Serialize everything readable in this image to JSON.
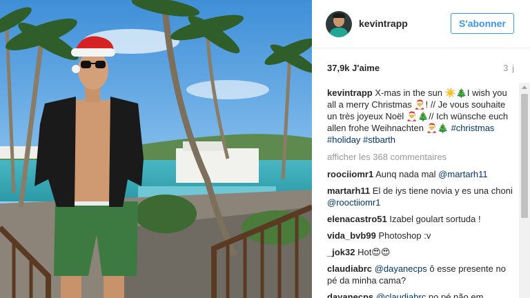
{
  "post": {
    "username": "kevintrapp",
    "follow_label": "S'abonner",
    "likes": "37,9k J'aime",
    "time_ago": "3 j"
  },
  "caption": {
    "username": "kevintrapp",
    "text": "X-mas in the sun ☀️🎄I wish you all a merry Christmas 🎅! // Je vous souhaite un très joyeux Noël 🎅🎄// Ich wünsche euch allen frohe Weihnachten 🎅🎄",
    "hashtags": "#christmas #holiday #stbarth"
  },
  "more_comments": "afficher les 368 commentaires",
  "comments": [
    {
      "user": "roociiomr1",
      "text": " Aunq nada mal ",
      "mention": "@martarh11"
    },
    {
      "user": "martarh11",
      "text": " El de iys tiene novia y es una choni ",
      "mention": "@rooctiiomr1"
    },
    {
      "user": "elenacastro51",
      "text": " Izabel goulart sortuda !",
      "mention": ""
    },
    {
      "user": "vida_bvb99",
      "text": " Photoshop :v",
      "mention": ""
    },
    {
      "user": "_jok32",
      "text": " Hot😍😍",
      "mention": ""
    },
    {
      "user": "claudiabrc",
      "text": " ô esse presente no pé da minha cama?",
      "mention": "@dayanecps",
      "mention_first": true
    },
    {
      "user": "dayanecps",
      "text": " no pé não em",
      "mention": "@claudiabrc",
      "mention_first": true
    }
  ],
  "colors": {
    "link": "#3897f0",
    "hashtag": "#003569",
    "muted": "#999999"
  }
}
